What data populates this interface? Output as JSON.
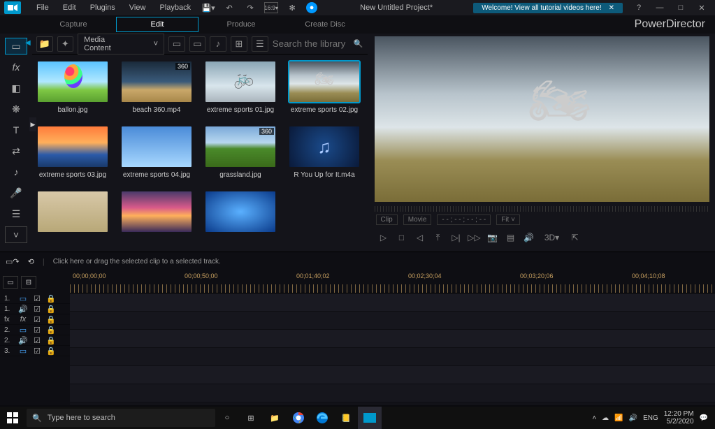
{
  "menu": {
    "items": [
      "File",
      "Edit",
      "Plugins",
      "View",
      "Playback"
    ]
  },
  "project_title": "New Untitled Project*",
  "tutorial_banner": "Welcome! View all tutorial videos here!",
  "brand": "PowerDirector",
  "modes": {
    "capture": "Capture",
    "edit": "Edit",
    "produce": "Produce",
    "create_disc": "Create Disc"
  },
  "library": {
    "dropdown": "Media Content",
    "search_placeholder": "Search the library",
    "clips": [
      {
        "name": "ballon.jpg",
        "art": "t-balloon"
      },
      {
        "name": "beach 360.mp4",
        "art": "t-beach",
        "badge": "360"
      },
      {
        "name": "extreme sports 01.jpg",
        "art": "t-bmx"
      },
      {
        "name": "extreme sports 02.jpg",
        "art": "t-moto",
        "selected": true
      },
      {
        "name": "extreme sports 03.jpg",
        "art": "t-surf"
      },
      {
        "name": "extreme sports 04.jpg",
        "art": "t-sky"
      },
      {
        "name": "grassland.jpg",
        "art": "t-grass",
        "badge": "360"
      },
      {
        "name": "R You Up for It.m4a",
        "art": "t-audio",
        "icon": "♫"
      },
      {
        "name": "",
        "art": "t-build"
      },
      {
        "name": "",
        "art": "t-sunset"
      },
      {
        "name": "",
        "art": "t-blue"
      }
    ]
  },
  "preview": {
    "clip_lbl": "Clip",
    "movie_lbl": "Movie",
    "timecode": "- - ; - - ; - - ; - -",
    "fit": "Fit",
    "d3": "3D"
  },
  "timeline": {
    "hint": "Click here or drag the selected clip to a selected track.",
    "times": [
      "00;00;00;00",
      "00;00;50;00",
      "00;01;40;02",
      "00;02;30;04",
      "00;03;20;06",
      "00;04;10;08"
    ],
    "tracks": [
      {
        "n": "1.",
        "ic": "▭",
        "c": "#4aa8ff"
      },
      {
        "n": "1.",
        "ic": "🔊",
        "c": "#4aa8ff"
      },
      {
        "n": "fx",
        "ic": "",
        "c": "#aaa"
      },
      {
        "n": "2.",
        "ic": "▭",
        "c": "#4aa8ff"
      },
      {
        "n": "2.",
        "ic": "🔊",
        "c": "#4aa8ff"
      },
      {
        "n": "3.",
        "ic": "▭",
        "c": "#4aa8ff"
      }
    ]
  },
  "taskbar": {
    "search": "Type here to search",
    "time": "12:20 PM",
    "date": "5/2/2020",
    "lang": "ENG"
  }
}
